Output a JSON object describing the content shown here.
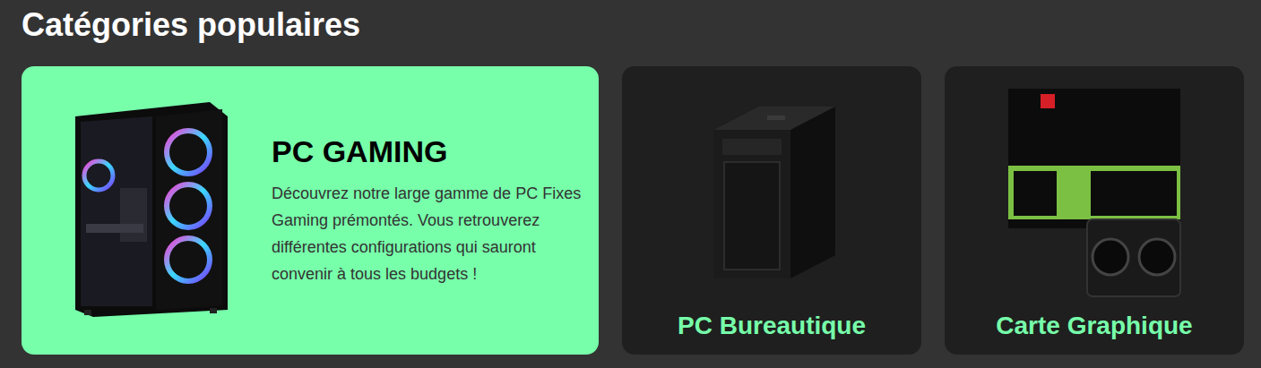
{
  "section": {
    "title": "Catégories populaires"
  },
  "categories": [
    {
      "kind": "featured",
      "name": "PC GAMING",
      "description": "Découvrez notre large gamme de PC Fixes Gaming prémontés. Vous retrouverez différentes configurations qui sauront convenir à tous les budgets !",
      "picture": "gaming-pc"
    },
    {
      "kind": "compact",
      "name": "PC Bureautique",
      "picture": "office-pc"
    },
    {
      "kind": "compact",
      "name": "Carte Graphique",
      "picture": "graphics-card"
    }
  ]
}
